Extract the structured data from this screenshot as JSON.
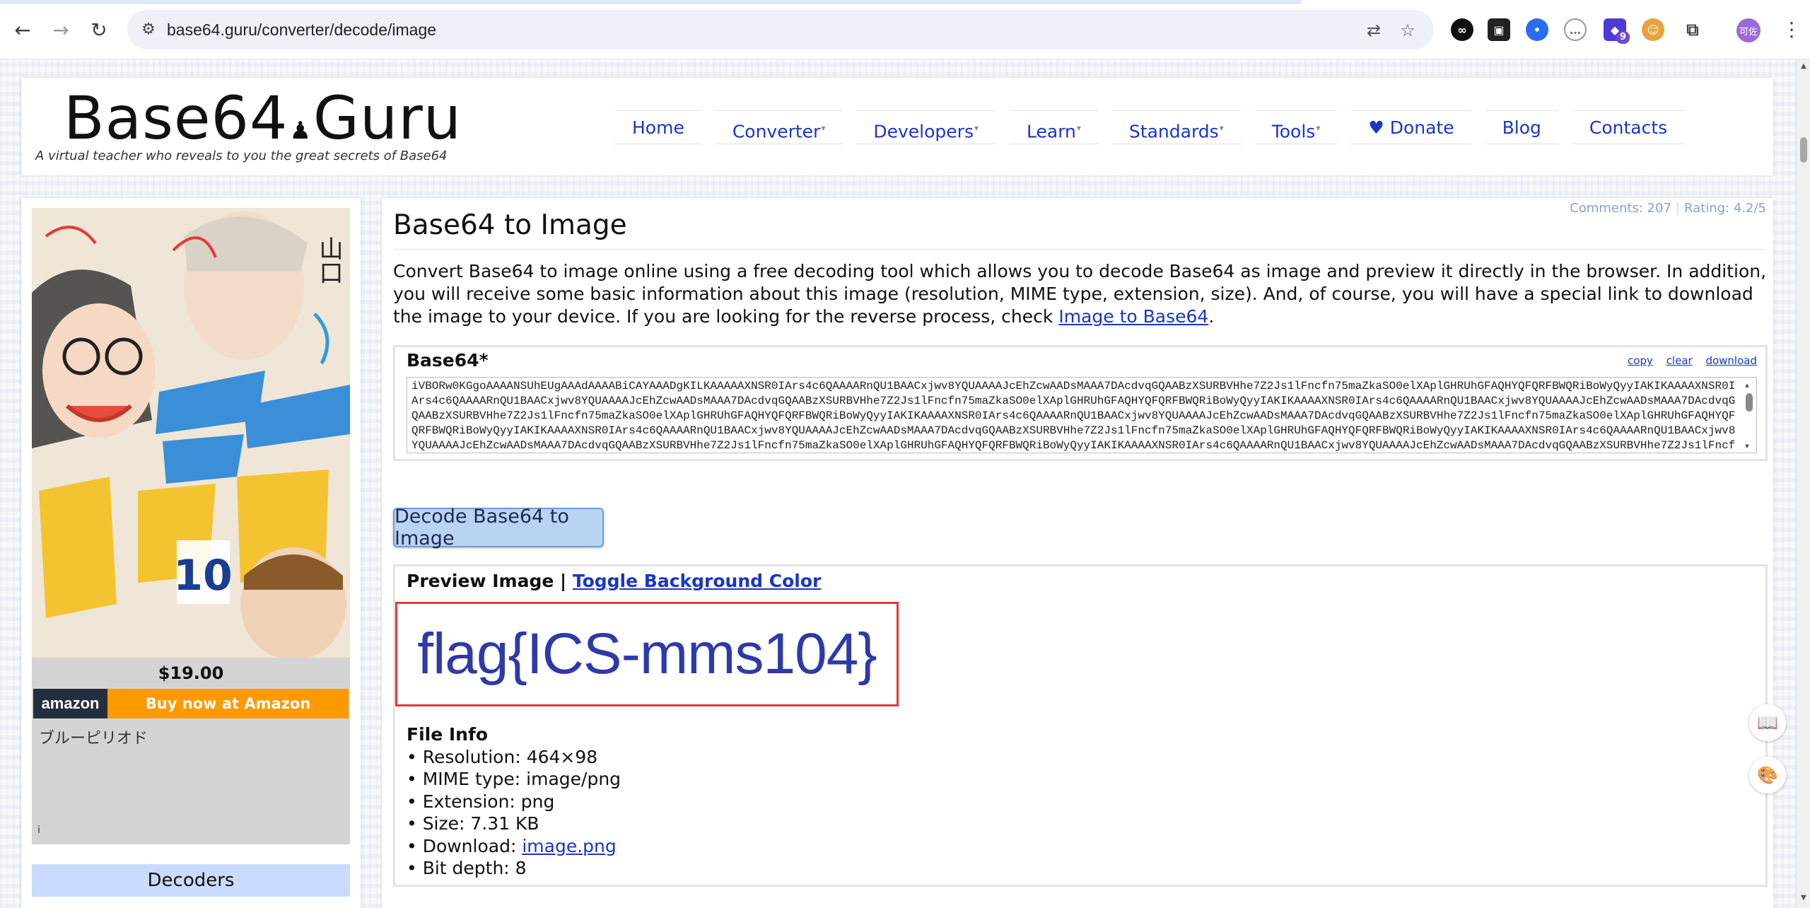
{
  "browser": {
    "url": "base64.guru/converter/decode/image",
    "profile_label": "可佐",
    "extension_badge": "9"
  },
  "site": {
    "logo_left": "Base64",
    "logo_right": "Guru",
    "tagline": "A virtual teacher who reveals to you the great secrets of Base64",
    "nav": [
      {
        "label": "Home",
        "caret": ""
      },
      {
        "label": "Converter",
        "caret": "▾"
      },
      {
        "label": "Developers",
        "caret": "▾"
      },
      {
        "label": "Learn",
        "caret": "▾"
      },
      {
        "label": "Standards",
        "caret": "▾"
      },
      {
        "label": "Tools",
        "caret": "▾"
      },
      {
        "label": "♥ Donate",
        "caret": ""
      },
      {
        "label": "Blog",
        "caret": ""
      },
      {
        "label": "Contacts",
        "caret": ""
      }
    ]
  },
  "sidebar": {
    "ad": {
      "price": "$19.00",
      "store_logo": "amazon",
      "buy_label": "Buy now at Amazon",
      "title": "ブルーピリオド",
      "info_icon": "i"
    },
    "section_title": "Decoders"
  },
  "main": {
    "comments": "Comments: 207",
    "rating": "Rating: 4.2/5",
    "title": "Base64 to Image",
    "intro": "Convert Base64 to image online using a free decoding tool which allows you to decode Base64 as image and preview it directly in the browser. In addition, you will receive some basic information about this image (resolution, MIME type, extension, size). And, of course, you will have a special link to download the image to your device. If you are looking for the reverse process, check ",
    "intro_link": "Image to Base64",
    "intro_end": ".",
    "base64_label": "Base64*",
    "actions": {
      "copy": "copy",
      "clear": "clear",
      "download": "download"
    },
    "base64_value": "iVBORw0KGgoAAAANSUhEUgAAAdAAAABiCAYAAADgKILKAAAAAXNSR0IArs4c6QAAAARnQU1BAACxjwv8YQUAAAAJcEhZcwAADsMAAA7DAcdvqGQAABzXSURBVHhe7Z2Js1lFncfn75maZkaSO0elXAplGHRUhGFAQHYQFQRFBWQRiBoWyQyyIAKIKAAAAXNSR0IArs4c6QAAAARnQU1BAACxjwv8YQUAAAAJcEhZcwAADsMAAA7DAcdvqGQAABzXSURBVHhe7Z2Js1lFncfn75maZkaSO0elXAplGHRUhGFAQHYQFQRFBWQRiBoWyQyyIAKIKAAAAXNSR0IArs4c6QAAAARnQU1BAACxjwv8YQUAAAAJcEhZcwAADsMAAA7DAcdvqGQAABzXSURBVHhe7Z2Js1lFncfn75maZkaSO0elXAplGHRUhGFAQHYQFQRFBWQRiBoWyQyyIAKIKAAAAXNSR0IArs4c6QAAAARnQU1BAACxjwv8YQUAAAAJcEhZcwAADsMAAA7DAcdvqGQAABzXSURBVHhe7Z2Js1lFncfn75maZkaSO0elXAplGHRUhGFAQHYQFQRFBWQRiBoWyQyyIAKIKAAAAXNSR0IArs4c6QAAAARnQU1BAACxjwv8YQUAAAAJcEhZcwAADsMAAA7DAcdvqGQAABzXSURBVHhe7Z2Js1lFncfn75maZkaSO0elXAplGHRUhGFAQHYQFQRFBWQRiBoWyQyyIAKIKAAAAXNSR0IArs4c6QAAAARnQU1BAACxjwv8YQUAAAAJcEhZcwAADsMAAA7DAcdvqGQAABzXSURBVHhe7Z2Js1lFncfn75maZkaSO0elXAplGHRUhGFAQHYQFQRFBWQRiBoWyQyyIAKIKAAAAXNSR0IArs4c6QAAAARnQU1BAACxjwv8YQUAAAAJcEhZcwAADsMAAA7DAcdvqGQAABzXSURBVHhe7Z2Js1lFncfn75maZkaSO0elXAplGHRUhGFAQHYQFQRFBWQRiBoWyQyyIAKIKAAAAXNSR0IArs4c6QAAAARnQU1BAACxjwv8YQUAAAAJcEhZcwAADsMAAA7DAcdvqGQAABzXSURBVHhe7Z2Js1lFncfn75maZkaSO0elXAplGHRUhGFAQHYQFQRFBWQRiBoWyQyyIAKI",
    "decode_button": "Decode Base64 to Image",
    "preview_label": "Preview Image | ",
    "toggle_label": "Toggle Background Color",
    "image_text": "flag{ICS-mms104}",
    "file_info": {
      "title": "File Info",
      "resolution": "• Resolution: 464×98",
      "mime": "• MIME type: image/png",
      "extension": "• Extension: png",
      "size": "• Size: 7.31 KB",
      "download_prefix": "• Download: ",
      "download_link": "image.png",
      "bit_depth": "• Bit depth: 8"
    }
  },
  "colors": {
    "link": "#1a35c8",
    "accent_button": "#b9d3f2",
    "highlight_border": "#e53935",
    "amazon_orange": "#ff9900"
  }
}
